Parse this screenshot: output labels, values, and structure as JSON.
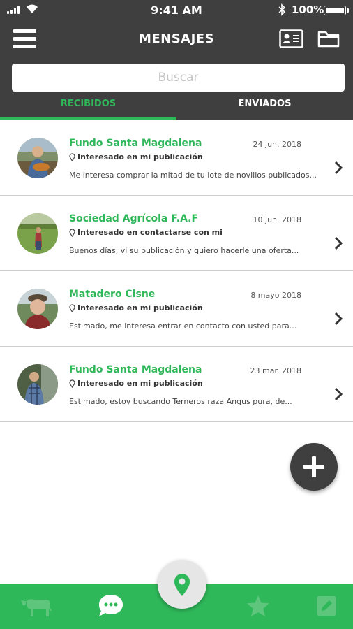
{
  "status_bar": {
    "time": "9:41 AM",
    "battery": "100%"
  },
  "header": {
    "title": "MENSAJES",
    "search_placeholder": "Buscar",
    "tabs": [
      {
        "label": "RECIBIDOS",
        "active": true
      },
      {
        "label": "ENVIADOS",
        "active": false
      }
    ]
  },
  "messages": [
    {
      "name": "Fundo Santa Magdalena",
      "date": "24 jun. 2018",
      "interest": "Interesado en mi publicación",
      "preview": "Me interesa comprar la mitad de tu lote de novillos publicados..."
    },
    {
      "name": "Sociedad Agrícola F.A.F",
      "date": "10 jun. 2018",
      "interest": "Interesado en contactarse con mi",
      "preview": "Buenos días, vi su publicación y quiero hacerle una oferta..."
    },
    {
      "name": "Matadero Cisne",
      "date": "8 mayo 2018",
      "interest": "Interesado en mi publicación",
      "preview": "Estimado, me interesa entrar en contacto con usted para..."
    },
    {
      "name": "Fundo Santa Magdalena",
      "date": "23 mar. 2018",
      "interest": "Interesado en mi publicación",
      "preview": "Estimado, estoy buscando Terneros raza Angus pura, de..."
    }
  ],
  "colors": {
    "header": "#3f3f3f",
    "accent": "#2fb85a",
    "divider": "#cfcfcf"
  },
  "icons": {
    "header": [
      "menu-icon",
      "contact-card-icon",
      "folder-icon"
    ],
    "bottom_nav": [
      "cow-icon",
      "chat-icon",
      "map-pin-icon",
      "star-icon",
      "edit-icon"
    ],
    "fab": "plus-icon"
  }
}
